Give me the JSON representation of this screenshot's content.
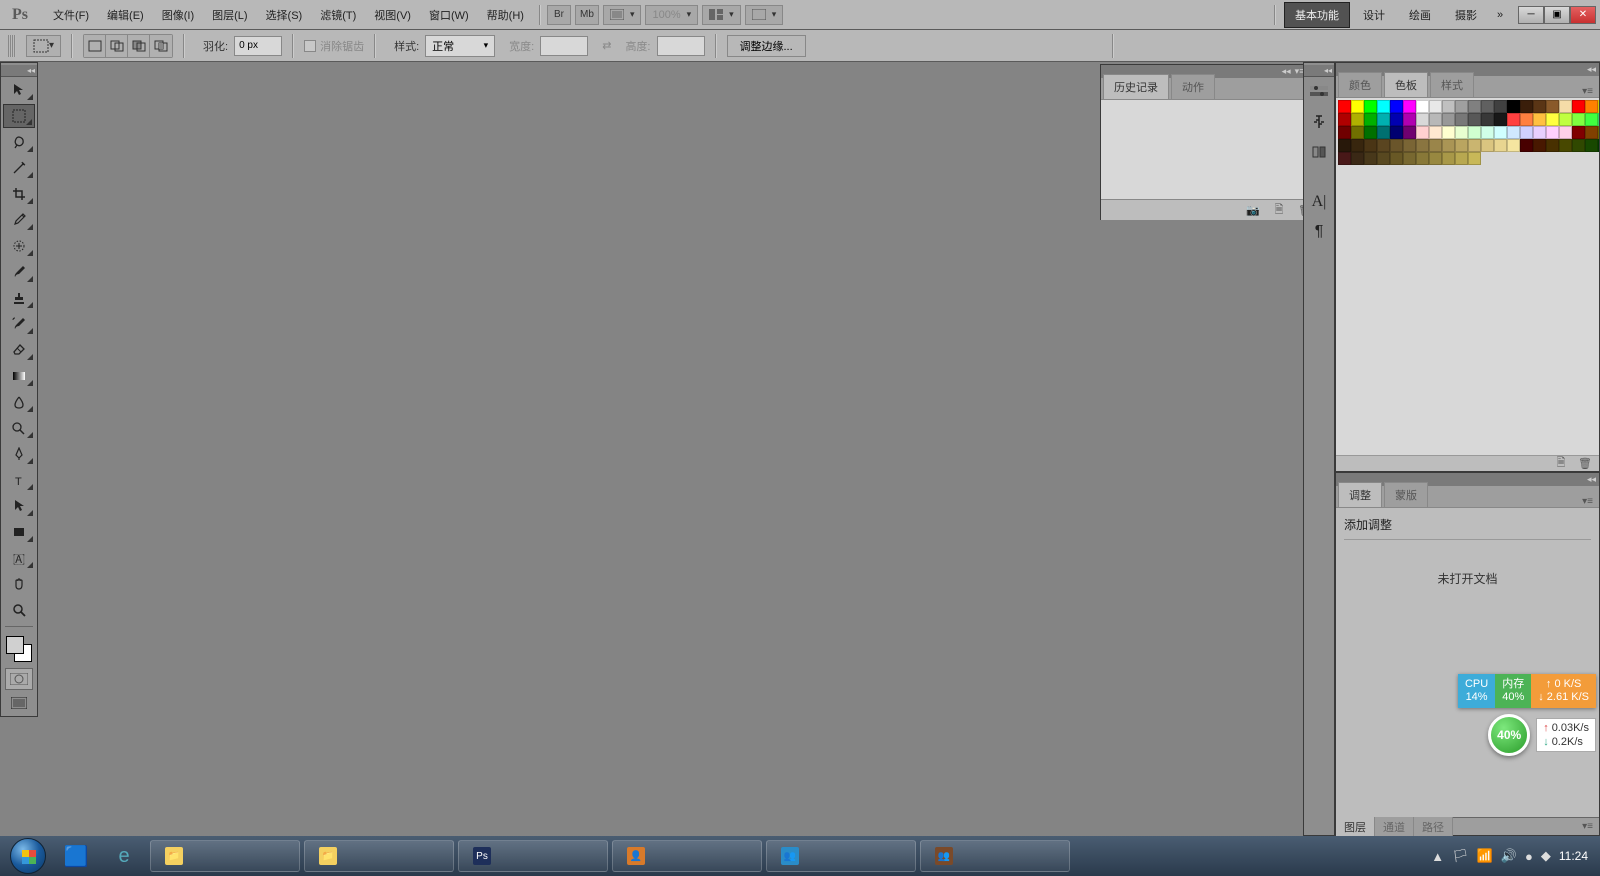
{
  "app": {
    "logo": "Ps"
  },
  "menu": {
    "items": [
      "文件(F)",
      "编辑(E)",
      "图像(I)",
      "图层(L)",
      "选择(S)",
      "滤镜(T)",
      "视图(V)",
      "窗口(W)",
      "帮助(H)"
    ],
    "br": "Br",
    "mb": "Mb",
    "zoom": "100%"
  },
  "workspace": {
    "tabs": [
      "基本功能",
      "设计",
      "绘画",
      "摄影"
    ],
    "more": "»"
  },
  "options": {
    "feather_label": "羽化:",
    "feather_value": "0 px",
    "antialias": "消除锯齿",
    "style_label": "样式:",
    "style_value": "正常",
    "width_label": "宽度:",
    "height_label": "高度:",
    "swap": "⇄",
    "refine": "调整边缘..."
  },
  "history_panel": {
    "tabs": [
      "历史记录",
      "动作"
    ]
  },
  "right_tabs": {
    "color": "颜色",
    "swatches": "色板",
    "styles": "样式"
  },
  "adjust_panel": {
    "tabs": [
      "调整",
      "蒙版"
    ],
    "title": "添加调整",
    "msg": "未打开文档"
  },
  "bottom_tabs": [
    "图层",
    "通道",
    "路径"
  ],
  "monitor": {
    "cpu_label": "CPU",
    "cpu_val": "14%",
    "mem_label": "内存",
    "mem_val": "40%",
    "up_label": "↑",
    "up_val": "0 K/S",
    "down_label": "↓",
    "down_val": "2.61 K/S",
    "circle": "40%",
    "net_up": "0.03K/s",
    "net_down": "0.2K/s"
  },
  "taskbar": {
    "items": [
      {
        "icon": "📁",
        "color": "#f4d060"
      },
      {
        "icon": "📁",
        "color": "#f4d060"
      },
      {
        "icon": "Ps",
        "color": "#1e2f5a"
      },
      {
        "icon": "👤",
        "color": "#d87a2a"
      },
      {
        "icon": "👥",
        "color": "#2a8cc8"
      },
      {
        "icon": "👥",
        "color": "#7a4a2a"
      }
    ],
    "time": "11:24"
  },
  "swatch_colors": [
    [
      "#ff0000",
      "#ffff00",
      "#00ff00",
      "#00ffff",
      "#0000ff",
      "#ff00ff",
      "#ffffff",
      "#e8e8e8",
      "#c0c0c0",
      "#a0a0a0",
      "#808080",
      "#606060",
      "#404040",
      "#000000",
      "#3a1e0a",
      "#5a3515",
      "#8a5a2a",
      "#f5dca8",
      "#ff0000",
      "#ff8000",
      "#ffff00",
      "#80ff00",
      "#00ff00",
      "#00ff80",
      "#00ffff",
      "#0080ff",
      "#0000ff",
      "#8000ff",
      "#ff00ff",
      "#ff0080",
      "#800000"
    ],
    [
      "#b00000",
      "#b0b000",
      "#00b000",
      "#00b0b0",
      "#0000b0",
      "#b000b0",
      "#d8d8d8",
      "#b8b8b8",
      "#989898",
      "#787878",
      "#585858",
      "#383838",
      "#181818",
      "#ff4040",
      "#ff8040",
      "#ffc040",
      "#ffff40",
      "#c0ff40",
      "#80ff40",
      "#40ff40",
      "#40ff80",
      "#40ffc0",
      "#40ffff",
      "#40c0ff",
      "#4080ff",
      "#4040ff",
      "#8040ff",
      "#c040ff",
      "#ff40ff",
      "#ff40c0",
      "#ff4080"
    ],
    [
      "#700000",
      "#707000",
      "#007000",
      "#007070",
      "#000070",
      "#700070",
      "#ffd0d0",
      "#ffe8d0",
      "#ffffd0",
      "#e8ffd0",
      "#d0ffd0",
      "#d0ffe8",
      "#d0ffff",
      "#d0e8ff",
      "#d0d0ff",
      "#e8d0ff",
      "#ffd0ff",
      "#ffd0e8",
      "#800000",
      "#804000",
      "#808000",
      "#408000",
      "#008000",
      "#008040",
      "#008080",
      "#004080",
      "#000080",
      "#400080",
      "#800080",
      "#800040",
      "#402020"
    ],
    [
      "#28180a",
      "#38260e",
      "#4a3515",
      "#5a4520",
      "#6a552a",
      "#7a6535",
      "#8a7540",
      "#9a854a",
      "#aa9555",
      "#baa560",
      "#cab570",
      "#dac580",
      "#e8d590",
      "#f5e5a0",
      "#480000",
      "#481800",
      "#483000",
      "#484800",
      "#304800",
      "#184800",
      "#004800",
      "#004818",
      "#004830",
      "#004848",
      "#003048",
      "#001848",
      "#000048",
      "#180048",
      "#300048",
      "#480048",
      "#480030"
    ],
    [
      "#481818",
      "#3a2815",
      "#48381a",
      "#584820",
      "#685825",
      "#786830",
      "#887838",
      "#988840",
      "#a89848",
      "#b8a850",
      "#c8b858",
      "",
      "",
      "",
      "",
      "",
      "",
      "",
      "",
      "",
      "",
      "",
      "",
      "",
      "",
      "",
      "",
      "",
      "",
      "",
      ""
    ]
  ]
}
